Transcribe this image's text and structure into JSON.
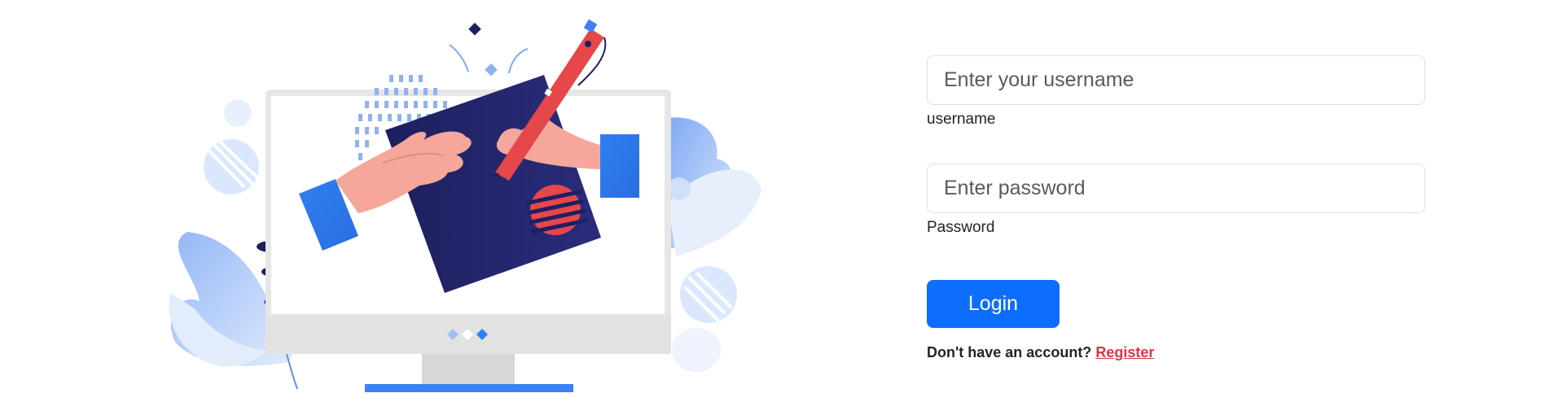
{
  "login_form": {
    "username": {
      "placeholder": "Enter your username",
      "label": "username"
    },
    "password": {
      "placeholder": "Enter password",
      "label": "Password"
    },
    "login_button": "Login",
    "register_prompt": "Don't have an account?",
    "register_link": "Register"
  },
  "colors": {
    "primary": "#0d6efd",
    "link": "#dc3545",
    "navy": "#1e2060",
    "illustration_blue": "#3b82f6",
    "illustration_red": "#e5474b"
  },
  "icons": [
    "computer-monitor-illustration",
    "hand-illustration",
    "pen-illustration",
    "leaf-illustration"
  ]
}
